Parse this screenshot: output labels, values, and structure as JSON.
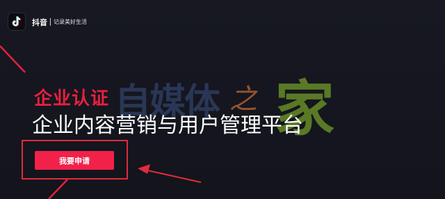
{
  "header": {
    "brand": "抖音",
    "slogan": "记录美好生活",
    "logo_icon": "tiktok-note-icon"
  },
  "hero": {
    "certification": "企业认证",
    "subtitle": "企业内容营销与用户管理平台"
  },
  "actions": {
    "apply_label": "我要申请"
  },
  "watermark": {
    "part1": "自媒体",
    "part2": "之",
    "part3": "家"
  },
  "colors": {
    "background": "#15161f",
    "accent": "#f1214a",
    "annotation": "#e02c3a",
    "watermark_green": "#6e9628",
    "watermark_orange": "#c46832"
  }
}
